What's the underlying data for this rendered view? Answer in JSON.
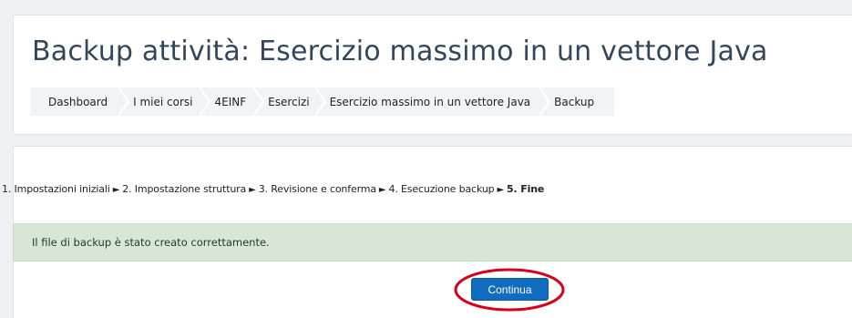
{
  "page": {
    "title": "Backup attività: Esercizio massimo in un vettore Java"
  },
  "breadcrumb": [
    {
      "label": "Dashboard"
    },
    {
      "label": "I miei corsi"
    },
    {
      "label": "4EINF"
    },
    {
      "label": "Esercizi"
    },
    {
      "label": "Esercizio massimo in un vettore Java"
    },
    {
      "label": "Backup"
    }
  ],
  "steps": {
    "items": [
      "1. Impostazioni iniziali",
      "2. Impostazione struttura",
      "3. Revisione e conferma",
      "4. Esecuzione backup",
      "5. Fine"
    ],
    "separator": "►",
    "current_index": 4
  },
  "alert": {
    "message": "Il file di backup è stato creato correttamente.",
    "type": "success"
  },
  "actions": {
    "continue_label": "Continua"
  },
  "colors": {
    "primary_button": "#0f6cbf",
    "success_alert_bg": "#d7e6d6",
    "annotation_ring": "#d6001c",
    "title_text": "#32475b"
  }
}
